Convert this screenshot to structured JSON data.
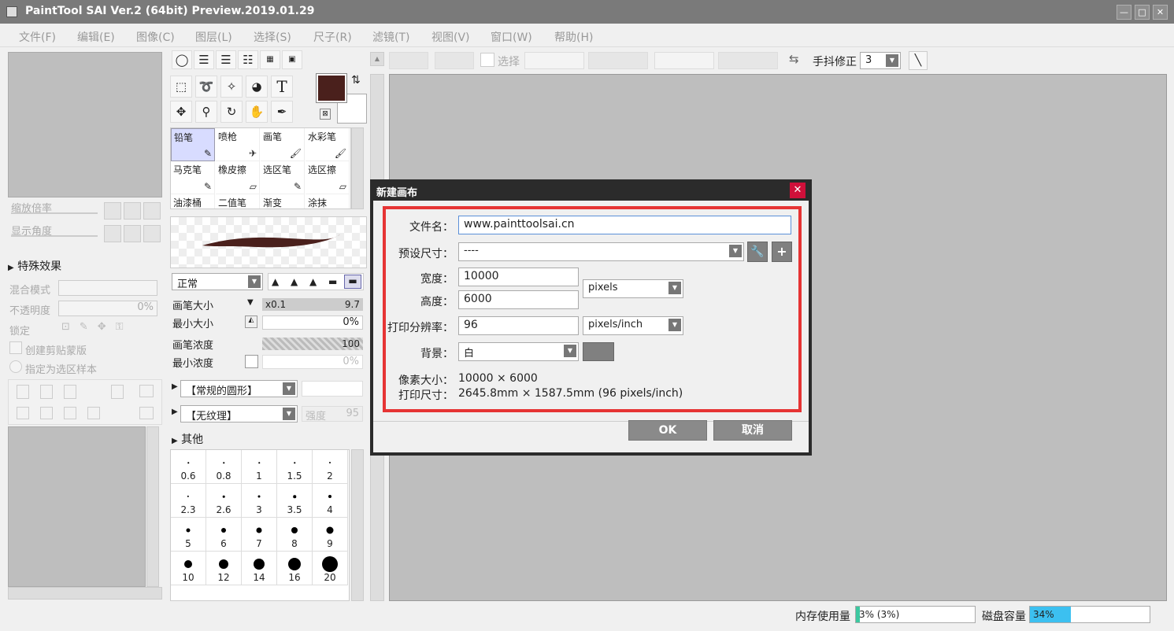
{
  "window": {
    "title": "PaintTool SAI Ver.2 (64bit) Preview.2019.01.29",
    "min": "—",
    "max": "□",
    "close": "✕"
  },
  "menu": [
    "文件(F)",
    "编辑(E)",
    "图像(C)",
    "图层(L)",
    "选择(S)",
    "尺子(R)",
    "滤镜(T)",
    "视图(V)",
    "窗口(W)",
    "帮助(H)"
  ],
  "navigator": {
    "zoom_label": "缩放倍率",
    "angle_label": "显示角度"
  },
  "layer_panel": {
    "section_title": "特殊效果",
    "blend_label": "混合模式",
    "opacity_label": "不透明度",
    "opacity_value": "0%",
    "lock_label": "锁定",
    "clip_label": "创建剪贴蒙版",
    "sample_label": "指定为选区样本"
  },
  "tools": {
    "text_icon": "T",
    "brushes": [
      {
        "name": "铅笔",
        "icon": "✎"
      },
      {
        "name": "喷枪",
        "icon": "✈"
      },
      {
        "name": "画笔",
        "icon": "🖌"
      },
      {
        "name": "水彩笔",
        "icon": "🖌"
      },
      {
        "name": "马克笔",
        "icon": "✎"
      },
      {
        "name": "橡皮擦",
        "icon": "▱"
      },
      {
        "name": "选区笔",
        "icon": "✎"
      },
      {
        "name": "选区擦",
        "icon": "▱"
      },
      {
        "name": "油漆桶",
        "icon": ""
      },
      {
        "name": "二值笔",
        "icon": ""
      },
      {
        "name": "渐变",
        "icon": ""
      },
      {
        "name": "涂抹",
        "icon": ""
      }
    ],
    "mode": "正常",
    "size_label": "画笔大小",
    "size_mult": "x0.1",
    "size_value": "9.7",
    "min_size_label": "最小大小",
    "min_size_value": "0%",
    "density_label": "画笔浓度",
    "density_value": "100",
    "min_density_label": "最小浓度",
    "min_density_value": "0%",
    "shape": "【常规的圆形】",
    "texture": "【无纹理】",
    "texture_strength_label": "强度",
    "texture_strength": "95",
    "other_label": "其他",
    "dot_sizes": [
      "0.6",
      "0.8",
      "1",
      "1.5",
      "2",
      "2.3",
      "2.6",
      "3",
      "3.5",
      "4",
      "5",
      "6",
      "7",
      "8",
      "9",
      "10",
      "12",
      "14",
      "16",
      "20"
    ],
    "primary_color": "#4a201c",
    "secondary_color": "#ffffff"
  },
  "toolbar": {
    "select_label": "选择",
    "stabilizer_label": "手抖修正",
    "stabilizer_value": "3"
  },
  "dialog": {
    "title": "新建画布",
    "filename_label": "文件名：",
    "filename_value": "www.painttoolsai.cn",
    "preset_label": "预设尺寸：",
    "preset_value": "----",
    "width_label": "宽度：",
    "width_value": "10000",
    "height_label": "高度：",
    "height_value": "6000",
    "unit_value": "pixels",
    "dpi_label": "打印分辨率：",
    "dpi_value": "96",
    "dpi_unit": "pixels/inch",
    "bg_label": "背景：",
    "bg_value": "白",
    "pixel_size_label": "像素大小：",
    "pixel_size_value": "10000 × 6000",
    "print_size_label": "打印尺寸：",
    "print_size_value": "2645.8mm × 1587.5mm (96 pixels/inch)",
    "ok": "OK",
    "cancel": "取消"
  },
  "status": {
    "mem_label": "内存使用量",
    "mem_value": "3% (3%)",
    "mem_fraction": 0.03,
    "disk_label": "磁盘容量",
    "disk_value": "34%",
    "disk_fraction": 0.34,
    "disk_color": "#3cc0f0"
  }
}
